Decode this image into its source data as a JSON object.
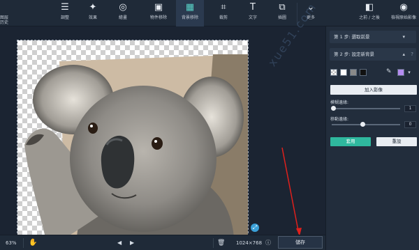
{
  "toolbar": {
    "left_small_1": "图层",
    "left_small_2": "历史",
    "tools": [
      {
        "label": "調整",
        "icon": "sliders-icon"
      },
      {
        "label": "效果",
        "icon": "effects-icon"
      },
      {
        "label": "繪畫",
        "icon": "paint-icon"
      },
      {
        "label": "物件移除",
        "icon": "object-remove-icon"
      },
      {
        "label": "背景移除",
        "icon": "background-remove-icon"
      },
      {
        "label": "裁剪",
        "icon": "crop-icon"
      },
      {
        "label": "文字",
        "icon": "text-icon"
      },
      {
        "label": "插圖",
        "icon": "insert-icon"
      },
      {
        "label": "更多",
        "icon": "chevron-down-icon"
      },
      {
        "label": "之前 / 之後",
        "icon": "before-after-icon"
      },
      {
        "label": "檢視原始影像",
        "icon": "eye-icon"
      }
    ]
  },
  "panel": {
    "step1": "第 1 步: 選取前景",
    "step2": "第 2 步: 設定新背景",
    "help": "?",
    "add_image": "加入影像",
    "blur_label": "模糊邊緣:",
    "blur_value": "1",
    "shift_label": "移動邊緣:",
    "shift_value": "0",
    "apply": "套用",
    "reset": "重設",
    "colors": {
      "gray": "#8a8a8a",
      "white": "#ffffff",
      "black": "#111111",
      "purple": "#b48cf0",
      "accent": "#2fb89e"
    }
  },
  "bottom": {
    "zoom": "63%",
    "dimensions": "1024×768",
    "save": "儲存"
  },
  "watermark": "xue51.com"
}
